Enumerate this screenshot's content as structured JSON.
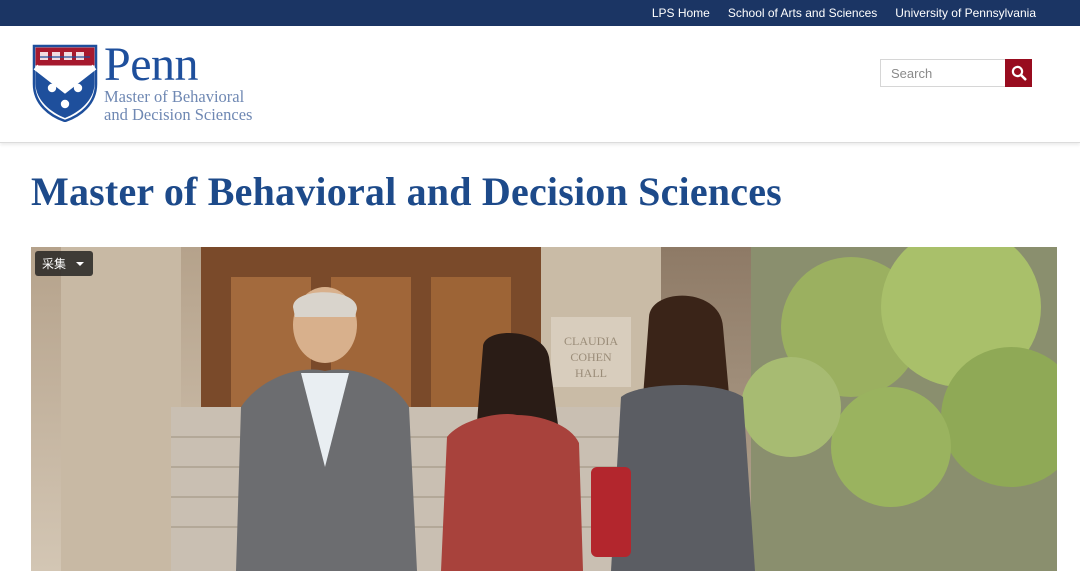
{
  "top_nav": {
    "links": [
      "LPS Home",
      "School of Arts and Sciences",
      "University of Pennsylvania"
    ]
  },
  "logo": {
    "wordmark": "Penn",
    "subtitle_line1": "Master of Behavioral",
    "subtitle_line2": "and Decision Sciences"
  },
  "search": {
    "placeholder": "Search",
    "icon": "search-icon"
  },
  "page": {
    "title": "Master of Behavioral and Decision Sciences"
  },
  "hero": {
    "collect_button_label": "采集",
    "collect_icon": "caret-down-icon",
    "building_inscription_1": "CLAUDIA",
    "building_inscription_2": "COHEN",
    "building_inscription_3": "HALL"
  },
  "colors": {
    "topbar": "#1b3564",
    "brand_blue": "#1d4a8a",
    "search_button": "#980c1f"
  }
}
